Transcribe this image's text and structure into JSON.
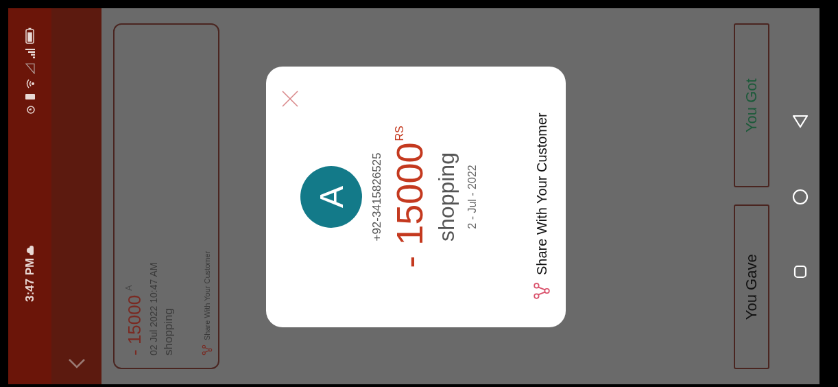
{
  "status_bar": {
    "time": "3:47 PM"
  },
  "entry": {
    "amount": "- 15000",
    "currency": "A",
    "datetime": "02 Jul 2022 10:47 AM",
    "note": "shopping",
    "share_label": "Share With Your Customer"
  },
  "dialog": {
    "avatar_letter": "A",
    "phone": "+92-3415826525",
    "amount": "- 15000",
    "currency": "RS",
    "note": "shopping",
    "date": "2 - Jul - 2022",
    "share_label": "Share With Your Customer"
  },
  "actions": [
    {
      "label": "You Gave",
      "kind": "gave"
    },
    {
      "label": "You Got",
      "kind": "got"
    }
  ]
}
